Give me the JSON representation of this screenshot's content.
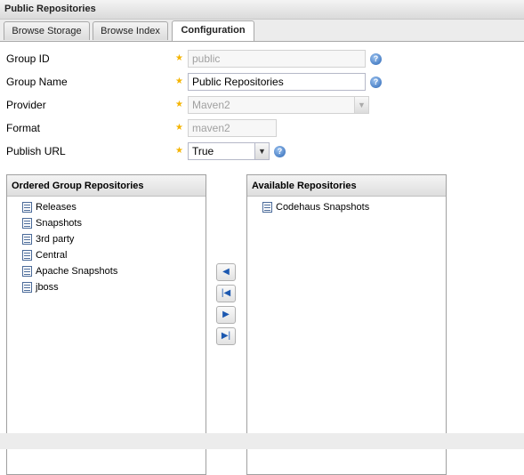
{
  "panel": {
    "title": "Public Repositories"
  },
  "tabs": [
    {
      "label": "Browse Storage"
    },
    {
      "label": "Browse Index"
    },
    {
      "label": "Configuration"
    }
  ],
  "form": {
    "group_id": {
      "label": "Group ID",
      "value": "public"
    },
    "group_name": {
      "label": "Group Name",
      "value": "Public Repositories"
    },
    "provider": {
      "label": "Provider",
      "value": "Maven2"
    },
    "format": {
      "label": "Format",
      "value": "maven2"
    },
    "publish_url": {
      "label": "Publish URL",
      "value": "True"
    }
  },
  "ordered": {
    "title": "Ordered Group Repositories",
    "items": [
      "Releases",
      "Snapshots",
      "3rd party",
      "Central",
      "Apache Snapshots",
      "jboss"
    ]
  },
  "available": {
    "title": "Available Repositories",
    "items": [
      "Codehaus Snapshots"
    ]
  },
  "icons": {
    "required": "required-star-icon",
    "help": "help-icon",
    "repository": "repository-icon",
    "move_left": "arrow-left-icon",
    "move_all_left": "arrow-first-icon",
    "move_right": "arrow-right-icon",
    "move_all_right": "arrow-last-icon"
  },
  "colors": {
    "required_star": "#f5b400",
    "help_icon": "#2b66b5",
    "disabled_text": "#a0a0a0"
  }
}
